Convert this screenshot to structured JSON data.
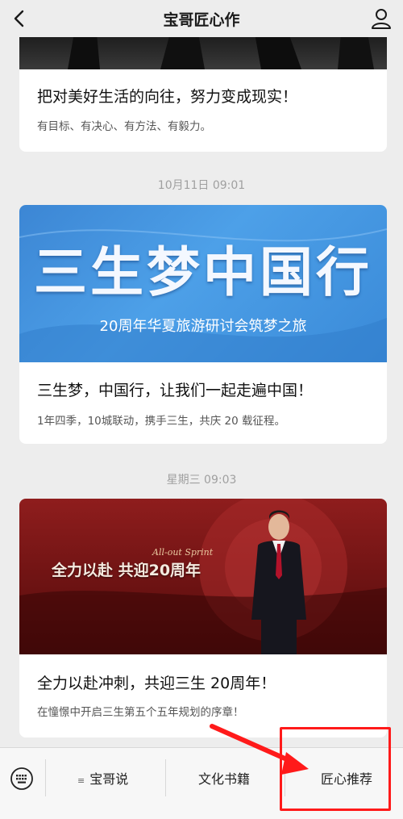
{
  "header": {
    "title": "宝哥匠心作"
  },
  "articles": [
    {
      "title": "把对美好生活的向往，努力变成现实！",
      "subtitle": "有目标、有决心、有方法、有毅力。"
    },
    {
      "time": "10月11日 09:01",
      "banner_title": "三生梦中国行",
      "banner_sub": "20周年华夏旅游研讨会筑梦之旅",
      "title": "三生梦，中国行，让我们一起走遍中国！",
      "subtitle": "1年四季，10城联动，携手三生，共庆 20 载征程。"
    },
    {
      "time": "星期三 09:03",
      "banner_title": "全力以赴 共迎20周年",
      "banner_script": "All-out Sprint",
      "title": "全力以赴冲刺，共迎三生 20周年！",
      "subtitle": "在憧憬中开启三生第五个五年规划的序章！"
    }
  ],
  "bottom_menu": {
    "tab1": "宝哥说",
    "tab1_icon": "≡",
    "tab2": "文化书籍",
    "tab3": "匠心推荐"
  },
  "colors": {
    "annotation": "#ff1a1a",
    "banner_blue": "#4a9be6",
    "banner_red": "#7a1414"
  },
  "icons": [
    "back-chevron-icon",
    "user-icon",
    "keyboard-icon",
    "menu-lines-icon"
  ]
}
